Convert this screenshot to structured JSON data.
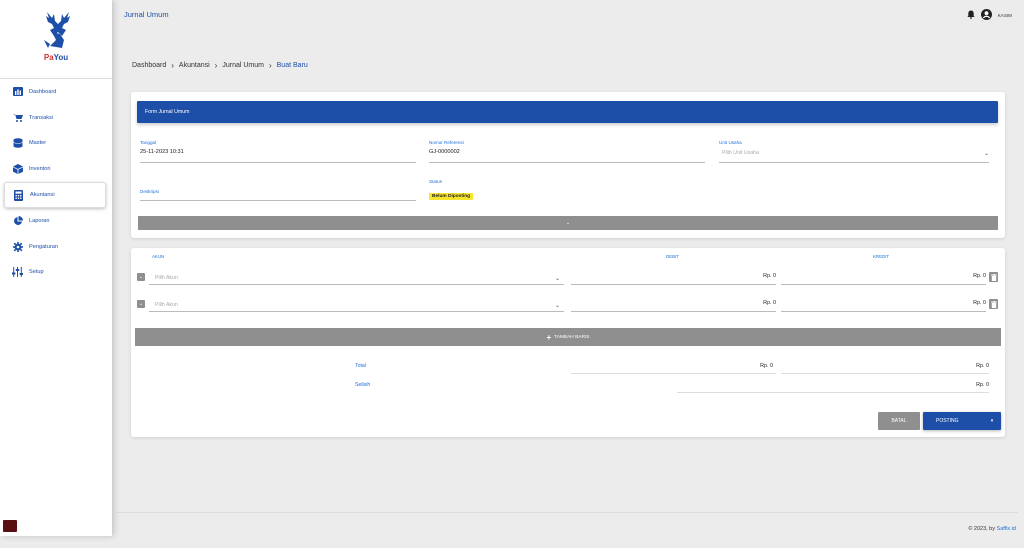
{
  "app": {
    "title": "Jurnal Umum",
    "brand_pa": "Pa",
    "brand_you": "You"
  },
  "user": {
    "name": "KASIM"
  },
  "sidebar": {
    "items": [
      {
        "label": "Dashboard",
        "icon": "chart-icon",
        "active": false
      },
      {
        "label": "Transaksi",
        "icon": "cart-icon",
        "active": false
      },
      {
        "label": "Master",
        "icon": "database-icon",
        "active": false
      },
      {
        "label": "Inventori",
        "icon": "box-icon",
        "active": false
      },
      {
        "label": "Akuntansi",
        "icon": "calculator-icon",
        "active": true
      },
      {
        "label": "Laporan",
        "icon": "pie-chart-icon",
        "active": false
      },
      {
        "label": "Pengaturan",
        "icon": "gear-icon",
        "active": false
      },
      {
        "label": "Setup",
        "icon": "sliders-icon",
        "active": false
      }
    ]
  },
  "breadcrumb": [
    "Dashboard",
    "Akuntansi",
    "Jurnal Umum",
    "Buat Baru"
  ],
  "form": {
    "header": "Form Jurnal Umum",
    "tanggal_label": "Tanggal",
    "tanggal_value": "25-11-2023 10:31",
    "nomor_label": "Nomor Referensi",
    "nomor_value": "GJ-0000002",
    "unit_label": "Unit Usaha",
    "unit_placeholder": "Pilih Unit Usaha",
    "deskripsi_label": "Deskripsi",
    "status_label": "Status",
    "status_value": "Belum Diposting"
  },
  "journal": {
    "headers": {
      "akun": "AKUN",
      "debit": "DEBIT",
      "kredit": "KREDIT"
    },
    "rows": [
      {
        "akun_placeholder": "Pilih Akun",
        "debit": "Rp. 0",
        "kredit": "Rp. 0"
      },
      {
        "akun_placeholder": "Pilih Akun",
        "debit": "Rp. 0",
        "kredit": "Rp. 0"
      }
    ],
    "add_row_label": "TAMBAH BARIS",
    "total_label": "Total",
    "total_debit": "Rp. 0",
    "total_kredit": "Rp. 0",
    "selisih_label": "Selisih",
    "selisih_value": "Rp. 0"
  },
  "actions": {
    "batal": "BATAL",
    "posting": "POSTING"
  },
  "footer": {
    "text": "© 2023, by ",
    "link": "Saffix.id"
  },
  "colors": {
    "primary": "#1e4fa8",
    "accent_label": "#1e6fd9",
    "badge": "#f6e52f",
    "grey_bar": "#8f8f8f"
  }
}
